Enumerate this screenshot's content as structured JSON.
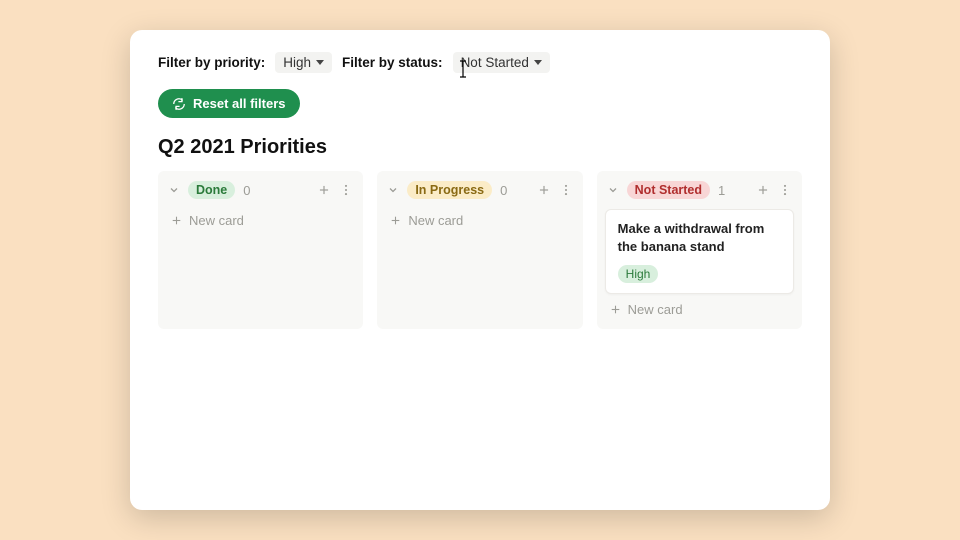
{
  "filters": {
    "priority_label": "Filter by priority:",
    "priority_value": "High",
    "status_label": "Filter by status:",
    "status_value": "Not Started"
  },
  "reset_label": "Reset all filters",
  "board_title": "Q2 2021 Priorities",
  "columns": [
    {
      "status": "Done",
      "pill_class": "pill-done",
      "count": "0",
      "cards": []
    },
    {
      "status": "In Progress",
      "pill_class": "pill-progress",
      "count": "0",
      "cards": []
    },
    {
      "status": "Not Started",
      "pill_class": "pill-notstarted",
      "count": "1",
      "cards": [
        {
          "title": "Make a withdrawal from the banana stand",
          "priority": "High"
        }
      ]
    }
  ],
  "new_card_label": "New card"
}
